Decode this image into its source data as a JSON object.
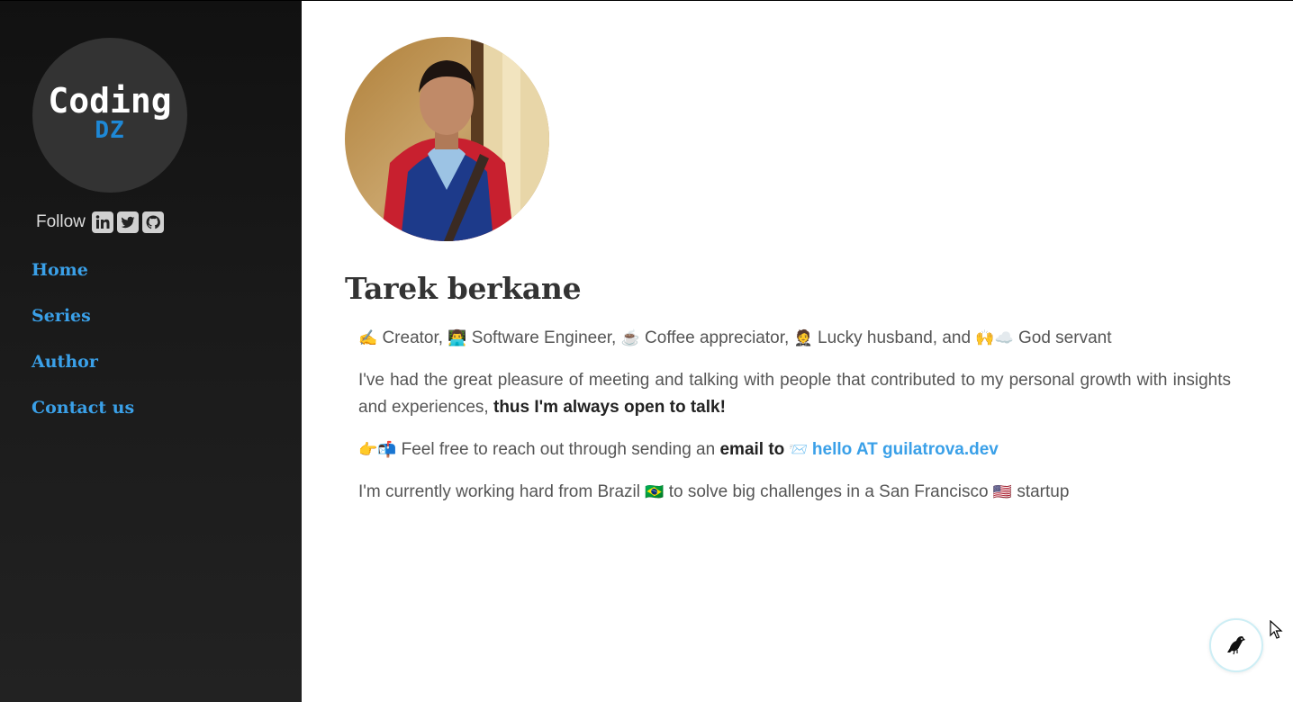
{
  "sidebar": {
    "logo": {
      "word": "Coding",
      "sub": "DZ"
    },
    "follow_label": "Follow",
    "social_icons": [
      "linkedin-icon",
      "twitter-icon",
      "github-icon"
    ],
    "nav": [
      {
        "label": "Home"
      },
      {
        "label": "Series"
      },
      {
        "label": "Author"
      },
      {
        "label": "Contact us"
      }
    ]
  },
  "author": {
    "name": "Tarek berkane",
    "bio": {
      "line1": {
        "e1": "✍️",
        "t1": " Creator, ",
        "e2": "👨‍💻",
        "t2": " Software Engineer, ",
        "e3": "☕",
        "t3": " Coffee appreciator, ",
        "e4": "🤵",
        "t4": " Lucky husband, and ",
        "e5": "🙌☁️",
        "t5": " God servant"
      },
      "line2": {
        "text": "I've had the great pleasure of meeting and talking with people that contributed to my personal growth with insights and experiences, ",
        "strong": "thus I'm always open to talk!"
      },
      "line3": {
        "emoji": "👉📬",
        "text": " Feel free to reach out through sending an ",
        "strong": "email to",
        "emoji2": " 📨 ",
        "link": "hello AT guilatrova.dev"
      },
      "line4": {
        "t1": "I'm currently working hard from Brazil ",
        "flag1": "🇧🇷",
        "t2": " to solve big challenges in a San Francisco ",
        "flag2": "🇺🇸",
        "t3": " startup"
      }
    }
  },
  "colors": {
    "accent": "#3aa0e8",
    "sidebar_bg": "#1a1a1a",
    "logo_blue": "#1e88d6",
    "text": "#555555"
  }
}
